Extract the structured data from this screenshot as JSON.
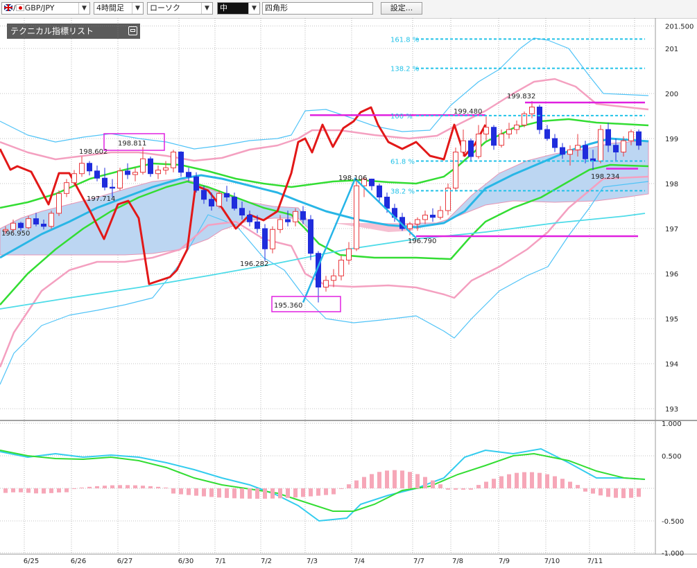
{
  "toolbar": {
    "pair": "GBP/JPY",
    "timeframe": "4時間足",
    "chart_style": "ローソク",
    "line_width": "中",
    "shape": "四角形",
    "settings": "設定..."
  },
  "indicator_panel": {
    "title": "テクニカル指標リスト"
  },
  "colors": {
    "bull": "#e8383d",
    "bear": "#1f2cdc",
    "ichimoku_cloud": "#bcd6f2",
    "ichimoku_cloud_neg": "#f5c0d2",
    "bb_outer": "#4fc3f7",
    "bb_inner": "#f4a0c0",
    "mid": "#33dd33",
    "fib": "#22c2e8",
    "drawn_lines": "#e020e0"
  },
  "chart_data": [
    {
      "type": "candlestick",
      "name": "main",
      "ylim": [
        192.7,
        201.6
      ],
      "y_ticks": [
        {
          "v": 201.5,
          "label": "201.500"
        },
        {
          "v": 201,
          "label": "201"
        },
        {
          "v": 200,
          "label": "200"
        },
        {
          "v": 199,
          "label": "199"
        },
        {
          "v": 198,
          "label": "198"
        },
        {
          "v": 197,
          "label": "197"
        },
        {
          "v": 196,
          "label": "196"
        },
        {
          "v": 195,
          "label": "195"
        },
        {
          "v": 194,
          "label": "194"
        },
        {
          "v": 193,
          "label": "193"
        }
      ],
      "x_labels": [
        "6/25",
        "6/26",
        "6/27",
        "6/30",
        "7/1",
        "7/2",
        "7/3",
        "7/4",
        "7/7",
        "7/8",
        "7/9",
        "7/10",
        "7/11"
      ],
      "candles": [
        [
          196.95,
          197.05,
          196.88,
          196.98
        ],
        [
          196.98,
          197.2,
          196.92,
          197.12
        ],
        [
          197.12,
          197.15,
          196.95,
          197.02
        ],
        [
          197.02,
          197.28,
          196.98,
          197.22
        ],
        [
          197.22,
          197.35,
          197.05,
          197.1
        ],
        [
          197.1,
          197.2,
          196.98,
          197.05
        ],
        [
          197.05,
          197.4,
          197.0,
          197.34
        ],
        [
          197.34,
          197.85,
          197.28,
          197.78
        ],
        [
          197.78,
          198.1,
          197.7,
          198.02
        ],
        [
          198.02,
          198.3,
          197.95,
          198.22
        ],
        [
          198.22,
          198.6,
          198.15,
          198.45
        ],
        [
          198.45,
          198.5,
          198.18,
          198.28
        ],
        [
          198.28,
          198.4,
          198.05,
          198.12
        ],
        [
          198.12,
          198.35,
          197.85,
          197.92
        ],
        [
          197.92,
          198.1,
          197.7,
          197.9
        ],
        [
          197.9,
          198.35,
          197.85,
          198.28
        ],
        [
          198.28,
          198.45,
          198.1,
          198.2
        ],
        [
          198.2,
          198.35,
          198.05,
          198.25
        ],
        [
          198.25,
          198.81,
          198.2,
          198.55
        ],
        [
          198.55,
          198.6,
          198.15,
          198.22
        ],
        [
          198.22,
          198.4,
          198.1,
          198.3
        ],
        [
          198.3,
          198.5,
          198.2,
          198.35
        ],
        [
          198.35,
          198.75,
          198.25,
          198.7
        ],
        [
          198.7,
          198.72,
          198.15,
          198.25
        ],
        [
          198.25,
          198.35,
          198.05,
          198.15
        ],
        [
          198.15,
          198.25,
          197.8,
          197.85
        ],
        [
          197.85,
          197.95,
          197.55,
          197.65
        ],
        [
          197.65,
          197.8,
          197.4,
          197.5
        ],
        [
          197.5,
          197.85,
          197.45,
          197.78
        ],
        [
          197.78,
          197.95,
          197.6,
          197.7
        ],
        [
          197.7,
          197.8,
          197.4,
          197.45
        ],
        [
          197.45,
          197.6,
          197.2,
          197.3
        ],
        [
          197.3,
          197.4,
          197.05,
          197.15
        ],
        [
          197.15,
          197.3,
          196.9,
          197.0
        ],
        [
          197.0,
          197.1,
          196.28,
          196.55
        ],
        [
          196.55,
          197.05,
          196.45,
          196.98
        ],
        [
          196.98,
          197.3,
          196.9,
          197.2
        ],
        [
          197.2,
          197.4,
          197.05,
          197.15
        ],
        [
          197.15,
          197.45,
          197.05,
          197.38
        ],
        [
          197.38,
          197.5,
          197.1,
          197.2
        ],
        [
          197.2,
          197.3,
          196.3,
          196.45
        ],
        [
          196.45,
          196.5,
          195.36,
          195.7
        ],
        [
          195.7,
          195.95,
          195.6,
          195.85
        ],
        [
          195.85,
          196.1,
          195.7,
          195.95
        ],
        [
          195.95,
          196.4,
          195.85,
          196.3
        ],
        [
          196.3,
          196.7,
          196.2,
          196.55
        ],
        [
          196.55,
          198.1,
          196.5,
          197.95
        ],
        [
          197.95,
          198.15,
          197.7,
          198.1
        ],
        [
          198.1,
          198.11,
          197.85,
          197.95
        ],
        [
          197.95,
          198.0,
          197.6,
          197.7
        ],
        [
          197.7,
          197.8,
          197.35,
          197.45
        ],
        [
          197.45,
          197.55,
          197.15,
          197.25
        ],
        [
          197.25,
          197.35,
          196.95,
          197.0
        ],
        [
          197.0,
          197.15,
          196.85,
          197.1
        ],
        [
          197.1,
          197.25,
          196.95,
          197.2
        ],
        [
          197.2,
          197.4,
          197.1,
          197.3
        ],
        [
          197.3,
          197.45,
          197.15,
          197.25
        ],
        [
          197.25,
          197.5,
          197.2,
          197.4
        ],
        [
          197.4,
          198.0,
          197.3,
          197.9
        ],
        [
          197.9,
          198.8,
          197.85,
          198.7
        ],
        [
          198.7,
          199.2,
          198.6,
          198.95
        ],
        [
          198.95,
          199.0,
          198.5,
          198.6
        ],
        [
          198.6,
          199.3,
          198.55,
          199.1
        ],
        [
          199.1,
          199.49,
          198.95,
          199.25
        ],
        [
          199.25,
          199.3,
          198.75,
          198.85
        ],
        [
          198.85,
          199.2,
          198.8,
          199.1
        ],
        [
          199.1,
          199.35,
          199.0,
          199.2
        ],
        [
          199.2,
          199.4,
          199.1,
          199.3
        ],
        [
          199.3,
          199.6,
          199.25,
          199.55
        ],
        [
          199.55,
          199.83,
          199.45,
          199.7
        ],
        [
          199.7,
          199.75,
          199.1,
          199.2
        ],
        [
          199.2,
          199.3,
          198.95,
          199.0
        ],
        [
          199.0,
          199.1,
          198.7,
          198.8
        ],
        [
          198.8,
          198.9,
          198.55,
          198.65
        ],
        [
          198.65,
          198.85,
          198.4,
          198.75
        ],
        [
          198.75,
          199.1,
          198.6,
          198.85
        ],
        [
          198.85,
          198.95,
          198.45,
          198.55
        ],
        [
          198.55,
          198.75,
          198.3,
          198.5
        ],
        [
          198.5,
          199.3,
          198.45,
          199.2
        ],
        [
          199.2,
          199.35,
          198.7,
          198.85
        ],
        [
          198.85,
          199.0,
          198.5,
          198.7
        ],
        [
          198.7,
          199.05,
          198.6,
          198.95
        ],
        [
          198.95,
          199.2,
          198.85,
          199.15
        ],
        [
          199.15,
          199.2,
          198.75,
          198.85
        ]
      ],
      "annotations": [
        {
          "label": "196.950",
          "v": 196.95
        },
        {
          "label": "197.714",
          "v": 197.714
        },
        {
          "label": "198.602",
          "v": 198.602
        },
        {
          "label": "198.811",
          "v": 198.811
        },
        {
          "label": "196.282",
          "v": 196.282
        },
        {
          "label": "195.360",
          "v": 195.36
        },
        {
          "label": "198.106",
          "v": 198.106
        },
        {
          "label": "196.790",
          "v": 196.79
        },
        {
          "label": "199.480",
          "v": 199.48
        },
        {
          "label": "199.832",
          "v": 199.832
        },
        {
          "label": "198.234",
          "v": 198.234
        }
      ],
      "fibonacci": [
        {
          "label": "161.8 %",
          "v": 201.21
        },
        {
          "label": "138.2 %",
          "v": 200.56
        },
        {
          "label": "100 %",
          "v": 199.51
        },
        {
          "label": "61.8 %",
          "v": 198.5
        },
        {
          "label": "38.2 %",
          "v": 197.84
        }
      ]
    },
    {
      "type": "macd",
      "name": "oscillator",
      "ylim": [
        -1.0,
        1.0
      ],
      "y_ticks": [
        {
          "v": 1.0,
          "label": "1.000"
        },
        {
          "v": 0.5,
          "label": "0.500"
        },
        {
          "v": -0.5,
          "label": "-0.500"
        },
        {
          "v": -1.0,
          "label": "-1.000"
        }
      ]
    }
  ]
}
